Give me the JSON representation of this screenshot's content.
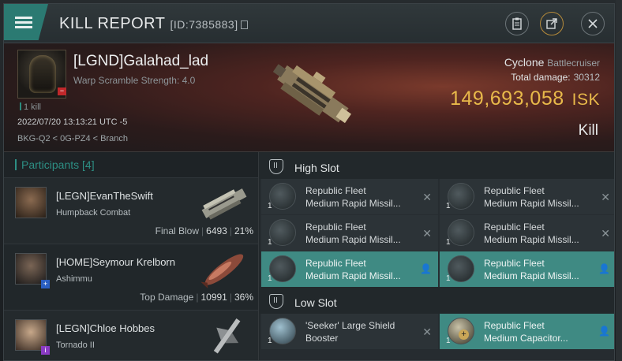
{
  "window": {
    "title": "KILL REPORT",
    "report_id": "[ID:7385883]",
    "icons": [
      "menu-icon",
      "clipboard-icon",
      "share-icon",
      "close-icon"
    ]
  },
  "victim": {
    "name": "[LGND]Galahad_lad",
    "warp_scramble": "Warp Scramble Strength: 4.0",
    "kill_count": "1 kill",
    "datetime": "2022/07/20 13:13:21 UTC -5",
    "location": "BKG-Q2 < 0G-PZ4 < Branch",
    "ship_name": "Cyclone",
    "ship_class": "Battlecruiser",
    "total_damage_label": "Total damage:",
    "total_damage": "30312",
    "isk_value": "149,693,058",
    "isk_unit": "ISK",
    "result": "Kill"
  },
  "participants": {
    "header": "Participants [4]",
    "items": [
      {
        "name": "[LEGN]EvanTheSwift",
        "ship": "Humpback Combat",
        "tag": "Final Blow",
        "damage": "6493",
        "percent": "21%"
      },
      {
        "name": "[HOME]Seymour Krelborn",
        "ship": "Ashimmu",
        "tag": "Top Damage",
        "damage": "10991",
        "percent": "36%"
      },
      {
        "name": "[LEGN]Chloe Hobbes",
        "ship": "Tornado II"
      }
    ]
  },
  "slots": {
    "high": {
      "label": "High Slot",
      "items": [
        {
          "qty": "1",
          "line1": "Republic Fleet",
          "line2": "Medium Rapid Missil...",
          "state": "destroyed"
        },
        {
          "qty": "1",
          "line1": "Republic Fleet",
          "line2": "Medium Rapid Missil...",
          "state": "destroyed"
        },
        {
          "qty": "1",
          "line1": "Republic Fleet",
          "line2": "Medium Rapid Missil...",
          "state": "destroyed"
        },
        {
          "qty": "1",
          "line1": "Republic Fleet",
          "line2": "Medium Rapid Missil...",
          "state": "destroyed"
        },
        {
          "qty": "1",
          "line1": "Republic Fleet",
          "line2": "Medium Rapid Missil...",
          "state": "dropped"
        },
        {
          "qty": "1",
          "line1": "Republic Fleet",
          "line2": "Medium Rapid Missil...",
          "state": "dropped"
        }
      ]
    },
    "low": {
      "label": "Low Slot",
      "items": [
        {
          "qty": "1",
          "line1": "'Seeker' Large Shield",
          "line2": "Booster",
          "state": "destroyed"
        },
        {
          "qty": "1",
          "line1": "Republic Fleet",
          "line2": "Medium Capacitor...",
          "state": "dropped"
        }
      ]
    }
  },
  "colors": {
    "accent": "#2b7a72",
    "isk": "#e8b94a",
    "dropped_bg": "#3f8a83",
    "destroyed_mark": "#8a9397"
  }
}
